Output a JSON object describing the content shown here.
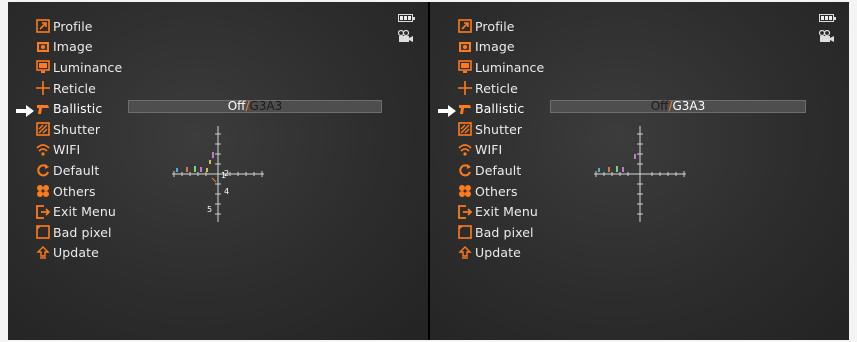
{
  "menu": {
    "items": [
      {
        "label": "Profile",
        "icon": "profile-icon"
      },
      {
        "label": "Image",
        "icon": "image-icon"
      },
      {
        "label": "Luminance",
        "icon": "luminance-icon"
      },
      {
        "label": "Reticle",
        "icon": "reticle-icon"
      },
      {
        "label": "Ballistic",
        "icon": "ballistic-icon"
      },
      {
        "label": "Shutter",
        "icon": "shutter-icon"
      },
      {
        "label": "WIFI",
        "icon": "wifi-icon"
      },
      {
        "label": "Default",
        "icon": "default-icon"
      },
      {
        "label": "Others",
        "icon": "others-icon"
      },
      {
        "label": "Exit Menu",
        "icon": "exit-menu-icon"
      },
      {
        "label": "Bad pixel",
        "icon": "bad-pixel-icon"
      },
      {
        "label": "Update",
        "icon": "update-icon"
      }
    ],
    "selected_index": 4,
    "selector_icon": "arrow-right-icon"
  },
  "ballistic": {
    "off_label": "Off",
    "separator": "/",
    "profile_label": "G3A3"
  },
  "reticle_preview": {
    "left_numbers": [
      "1",
      "2",
      "4",
      "5"
    ]
  },
  "status": {
    "battery_icon": "battery-icon",
    "battery_cells": 3,
    "mode_icon": "video-camera-icon"
  },
  "colors": {
    "accent": "#ff7a1a",
    "background": "#2e2e2e",
    "text": "#ececec",
    "value_bar": "#4e4e4e"
  }
}
